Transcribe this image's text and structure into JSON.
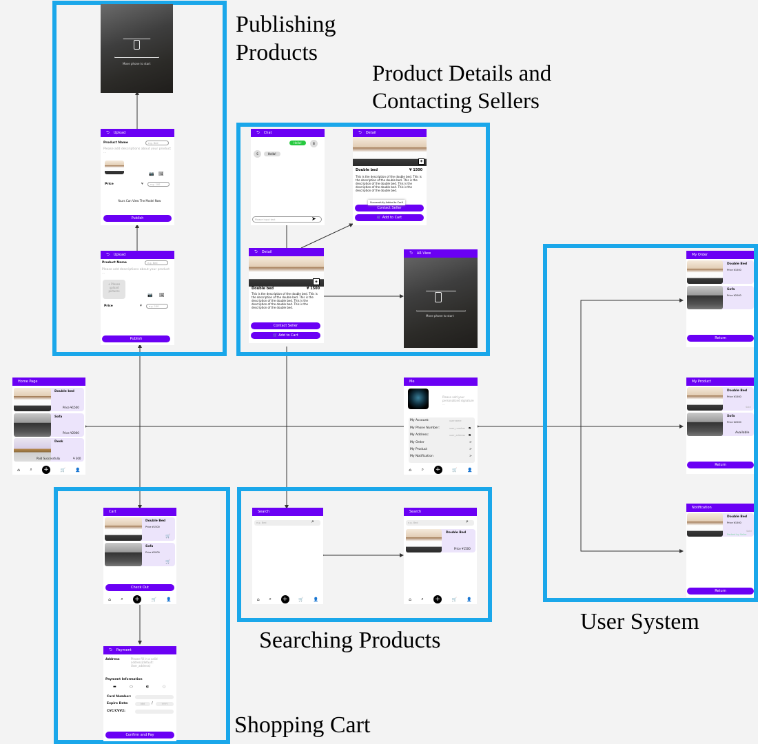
{
  "labels": {
    "publishing": "Publishing Products",
    "product_details": "Product Details and Contacting Sellers",
    "user_system": "User System",
    "searching": "Searching Products",
    "shopping_cart": "Shopping Cart"
  },
  "colors": {
    "group_border": "#1aa7ea",
    "accent": "#6a00f4",
    "card": "#ece4fb"
  },
  "ar": {
    "hint": "Move phone to start"
  },
  "upload_form": {
    "title": "Upload",
    "product_name": "Product Name",
    "name_placeholder": "e.g. Bed",
    "desc_placeholder": "Please add descriptions about your product ...",
    "price": "Price",
    "currency": "¥",
    "price_placeholder": "e.g. 100",
    "model_note": "Yours Can View The Model Now",
    "publish": "Publish",
    "upload_placeholder": "+ Please upload pictures"
  },
  "chat": {
    "title": "Chat",
    "msg_hello_sent": "Hello!",
    "avatar_b": "B",
    "avatar_s": "S",
    "msg_hello_recv": "Hello!",
    "input_placeholder": "Please input text"
  },
  "detail": {
    "title": "Detail",
    "name": "Double bed",
    "price": "¥ 1500",
    "description": "This is the description of the double bed. This is the description of the double bed. This is the description of the double bed. This is the description of the double bed. This is the description of the double bed.",
    "toast": "Successfully Added to Cart!",
    "contact": "Contact Seller",
    "add_cart": "Add to Cart"
  },
  "ar_view": {
    "title": "AR View"
  },
  "home": {
    "title": "Home Page",
    "items": [
      {
        "name": "Double bed",
        "status": "",
        "price": "Price ¥1500"
      },
      {
        "name": "Sofa",
        "status": "",
        "price": "Price ¥2000"
      },
      {
        "name": "Desk",
        "status": "Paid Successfully",
        "price": "¥ 300"
      }
    ]
  },
  "me": {
    "title": "Me",
    "signature": "Please add your personalized signature ...",
    "rows": [
      {
        "label": "My Account:",
        "value": "username"
      },
      {
        "label": "My Phone Number:",
        "value": "user_number"
      },
      {
        "label": "My Address:",
        "value": "user_address"
      },
      {
        "label": "My Order",
        "value": ""
      },
      {
        "label": "My Product",
        "value": ""
      },
      {
        "label": "My Notification",
        "value": ""
      }
    ]
  },
  "my_order": {
    "title": "My Order",
    "items": [
      {
        "name": "Double Bed",
        "price": "Price ¥1500"
      },
      {
        "name": "Sofa",
        "price": "Price ¥2000"
      }
    ],
    "return": "Return"
  },
  "my_product": {
    "title": "My Product",
    "items": [
      {
        "name": "Double Bed",
        "price": "Price ¥1500",
        "status": "Sold"
      },
      {
        "name": "Sofa",
        "price": "Price ¥2000",
        "status": "Available"
      }
    ],
    "return": "Return"
  },
  "notification": {
    "title": "Notification",
    "item": {
      "name": "Double Bed",
      "price": "Price ¥1500",
      "status1": "Sold",
      "status2": "Packed by Seller"
    },
    "return": "Return"
  },
  "cart": {
    "title": "Cart",
    "items": [
      {
        "name": "Double Bed",
        "price": "Price ¥1500"
      },
      {
        "name": "Sofa",
        "price": "Price ¥2000"
      }
    ],
    "checkout": "Check Out"
  },
  "payment": {
    "title": "Payment",
    "address": "Address",
    "address_placeholder": "Please fill in a valid address(default: User_address)",
    "info": "Payment Information",
    "card_number": "Card Number:",
    "expire": "Expire Date:",
    "mm": "MM",
    "yyyy": "YYYY",
    "slash": "/",
    "cvc": "CVC/CVV2:",
    "confirm": "Confirm and Pay"
  },
  "search": {
    "title": "Search",
    "placeholder": "e.g. Bed",
    "result": {
      "name": "Double Bed",
      "price": "Price ¥1500"
    }
  }
}
